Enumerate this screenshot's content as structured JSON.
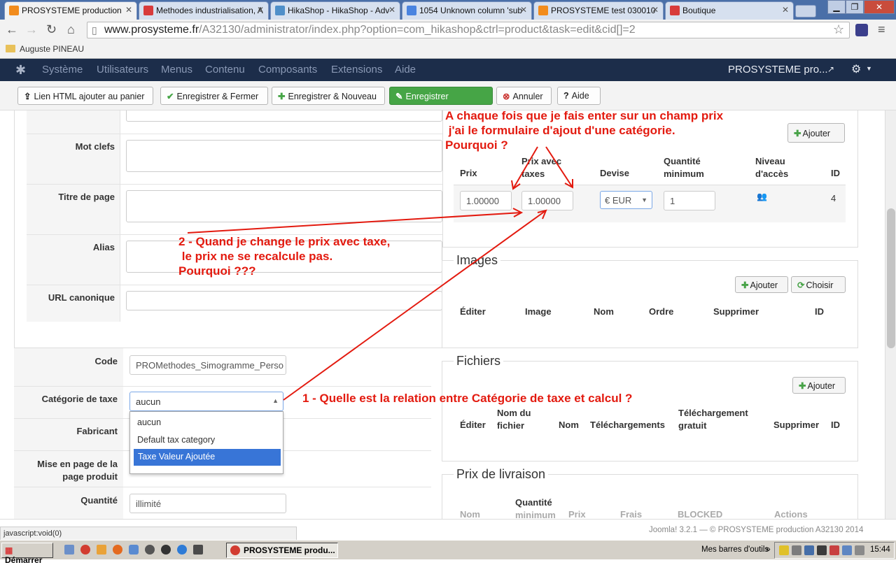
{
  "browser": {
    "tabs": [
      {
        "title": "PROSYSTEME production"
      },
      {
        "title": "Methodes industrialisation, A"
      },
      {
        "title": "HikaShop - HikaShop - Adv"
      },
      {
        "title": "1054 Unknown column 'sub"
      },
      {
        "title": "PROSYSTEME test 030010"
      },
      {
        "title": "Boutique"
      }
    ],
    "url_host": "www.prosysteme.fr",
    "url_path": "/A32130/administrator/index.php?option=com_hikashop&ctrl=product&task=edit&cid[]=2",
    "bookmark": "Auguste PINEAU"
  },
  "joomla_nav": {
    "items": [
      "Système",
      "Utilisateurs",
      "Menus",
      "Contenu",
      "Composants",
      "Extensions",
      "Aide"
    ],
    "site_name": "PROSYSTEME pro..."
  },
  "toolbar": {
    "html_link": "Lien HTML ajouter au panier",
    "save_close": "Enregistrer & Fermer",
    "save_new": "Enregistrer & Nouveau",
    "save": "Enregistrer",
    "cancel": "Annuler",
    "help": "Aide"
  },
  "left_form": {
    "meta_keywords_label": "Mot clefs",
    "page_title_label": "Titre de page",
    "alias_label": "Alias",
    "canonical_label": "URL canonique",
    "code_label": "Code",
    "code_value": "PROMethodes_Simogramme_Perso",
    "tax_category_label": "Catégorie de taxe",
    "tax_category_value": "aucun",
    "tax_options": [
      "aucun",
      "Default tax category",
      "Taxe Valeur Ajoutée"
    ],
    "manufacturer_label": "Fabricant",
    "layout_label_1": "Mise en page de la",
    "layout_label_2": "page produit",
    "quantity_label": "Quantité",
    "quantity_value": "illimité"
  },
  "prices": {
    "add_button": "Ajouter",
    "headers": {
      "price": "Prix",
      "price_tax_1": "Prix avec",
      "price_tax_2": "taxes",
      "currency": "Devise",
      "min_qty_1": "Quantité",
      "min_qty_2": "minimum",
      "access_1": "Niveau",
      "access_2": "d'accès",
      "id": "ID"
    },
    "row": {
      "price": "1.00000",
      "price_tax": "1.00000",
      "currency": "€ EUR",
      "min_qty": "1",
      "id": "4"
    }
  },
  "images": {
    "title": "Images",
    "add_button": "Ajouter",
    "choose_button": "Choisir",
    "headers": [
      "Éditer",
      "Image",
      "Nom",
      "Ordre",
      "Supprimer",
      "ID"
    ]
  },
  "files": {
    "title": "Fichiers",
    "add_button": "Ajouter",
    "headers": {
      "edit": "Éditer",
      "filename_1": "Nom du",
      "filename_2": "fichier",
      "name": "Nom",
      "downloads": "Téléchargements",
      "free_1": "Téléchargement",
      "free_2": "gratuit",
      "delete": "Supprimer",
      "id": "ID"
    }
  },
  "shipping": {
    "title": "Prix de livraison",
    "headers": {
      "name": "Nom",
      "min_qty_1": "Quantité",
      "min_qty_2": "minimum",
      "price": "Prix",
      "fees": "Frais",
      "blocked": "BLOCKED",
      "actions": "Actions"
    }
  },
  "annotations": {
    "top": "A chaque fois que je fais enter sur un champ prix\n j'ai le formulaire d'ajout d'une catégorie.\nPourquoi ?",
    "middle": "2 - Quand je change le prix avec taxe,\n le prix ne se recalcule pas.\nPourquoi ???",
    "bottom": "1 - Quelle est la relation entre Catégorie de taxe et calcul ?"
  },
  "status": {
    "link": "javascript:void(0)",
    "footer": "Joomla! 3.2.1  —  © PROSYSTEME production A32130 2014"
  },
  "taskbar": {
    "start": "Démarrer",
    "window": "PROSYSTEME produ...",
    "toolbars": "Mes barres d'outils",
    "clock": "15:44"
  },
  "colors": {
    "joomla_nav": "#1c2d4a",
    "save_green": "#46a546",
    "annotation_red": "#e31a0f",
    "selected_option": "#3875d7"
  }
}
